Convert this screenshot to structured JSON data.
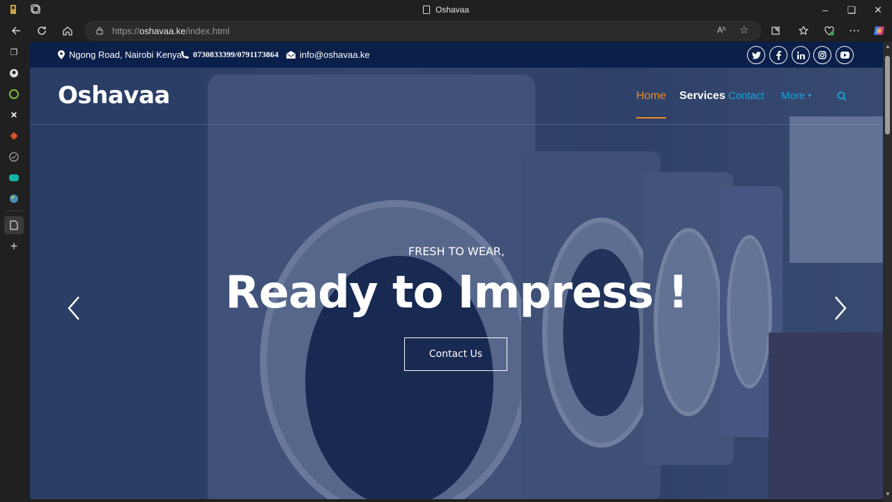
{
  "browser": {
    "window_title": "Oshavaa",
    "url_prefix": "https://",
    "url_domain": "oshavaa.ke",
    "url_path": "/index.html",
    "icons": [
      "app-icon",
      "tabs-icon",
      "back-icon",
      "refresh-icon",
      "home-icon",
      "lock-icon",
      "read-aloud-icon",
      "favorite-icon",
      "extensions-icon",
      "favorites-icon",
      "health-icon",
      "more-icon",
      "copilot-icon"
    ]
  },
  "sidebar": {
    "items": [
      "tabs-icon",
      "github-icon",
      "coin-icon",
      "x-icon",
      "git-icon",
      "check-icon",
      "tag-icon",
      "globe-icon",
      "page-icon",
      "add-icon"
    ]
  },
  "site": {
    "topbar": {
      "address": "Ngong Road, Nairobi Kenya.",
      "phone": "0730833399/0791173864",
      "email": "info@oshavaa.ke"
    },
    "social": [
      "twitter-icon",
      "facebook-icon",
      "linkedin-icon",
      "instagram-icon",
      "youtube-icon"
    ],
    "brand": "Oshavaa",
    "nav": {
      "home": "Home",
      "services": "Services",
      "contact": "Contact",
      "more": "More"
    },
    "hero": {
      "subtitle": "FRESH TO WEAR,",
      "title": "Ready to Impress !",
      "cta": "Contact Us"
    }
  },
  "colors": {
    "topbar_bg": "#0a1f4a",
    "nav_active": "#f08a24",
    "nav_link": "#1ea0d8"
  }
}
